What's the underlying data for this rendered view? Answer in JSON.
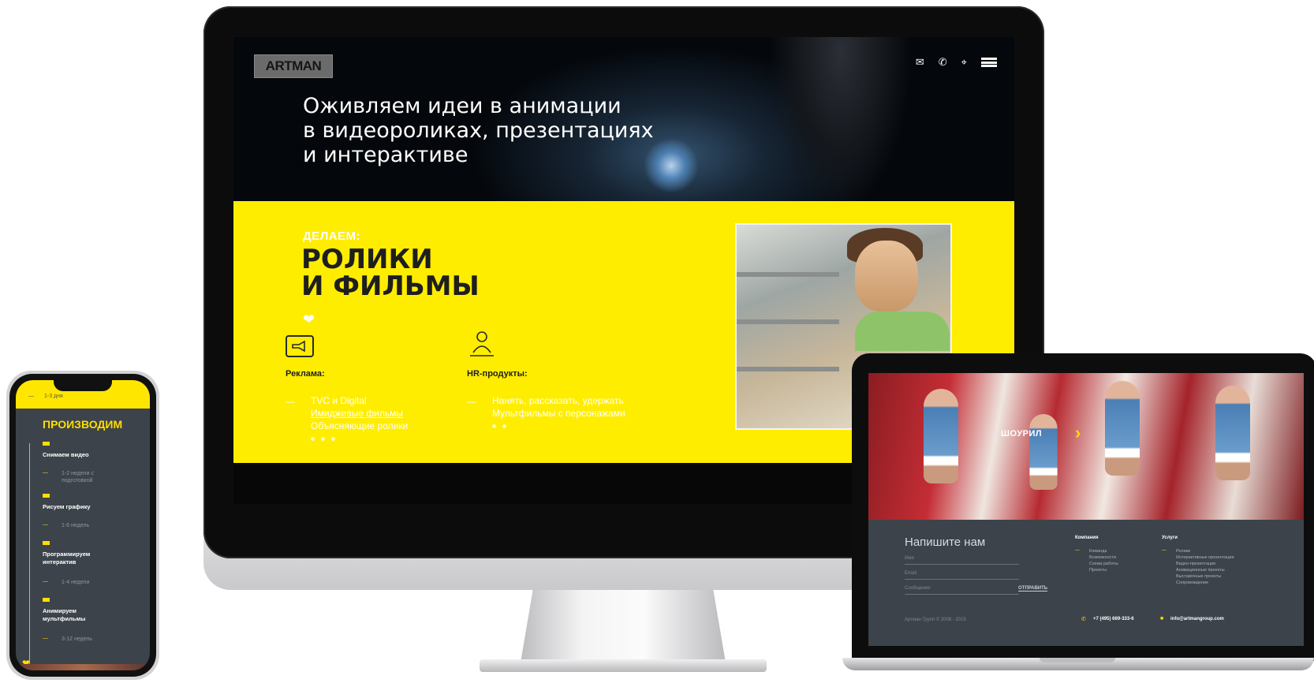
{
  "desktop": {
    "logo": "ARTMAN",
    "nav_icons": [
      "mail-icon",
      "phone-icon",
      "location-icon",
      "menu-icon"
    ],
    "hero_lines": [
      "Оживляем идеи в анимации",
      "в видеороликах, презентациях",
      "и интерактиве"
    ],
    "kicker": "ДЕЛАЕМ:",
    "headline_lines": [
      "РОЛИКИ",
      "И ФИЛЬМЫ"
    ],
    "col1": {
      "title": "Реклама:",
      "items": [
        "TVC и Digital",
        "Имиджевые фильмы",
        "Объясняющие ролики"
      ]
    },
    "col2": {
      "title": "HR-продукты:",
      "items": [
        "Нанять, рассказать, удержать",
        "Мультфильмы с персонажами"
      ]
    },
    "accent": "#ffed00"
  },
  "laptop": {
    "showreel": "ШОУРИЛ",
    "form_title": "Напишите нам",
    "placeholders": [
      "Имя",
      "Email",
      "Сообщение"
    ],
    "send": "ОТПРАВИТЬ",
    "col1": {
      "title": "Компания",
      "items": [
        "Команда",
        "Возможности",
        "Схема работы",
        "Проекты"
      ]
    },
    "col2": {
      "title": "Услуги",
      "items": [
        "Ролики",
        "Интерактивные презентации",
        "Видео-презентации",
        "Анимационные проекты",
        "Выставочные проекты",
        "Сопровождение"
      ]
    },
    "copyright": "Артман Групп © 2008 - 2015",
    "phone": "+7 (495) 669-333-6",
    "email": "info@artmangroup.com"
  },
  "phone": {
    "top_duration": "1-3 дня",
    "title": "ПРОИЗВОДИМ",
    "steps": [
      {
        "label": "Снимаем видео",
        "duration": "1-2 недели с подготовкой"
      },
      {
        "label": "Рисуем графику",
        "duration": "1-6 недель"
      },
      {
        "label": "Программируем интерактив",
        "duration": "1-4 недели"
      },
      {
        "label": "Анимируем мультфильмы",
        "duration": "3-12 недель"
      }
    ]
  }
}
